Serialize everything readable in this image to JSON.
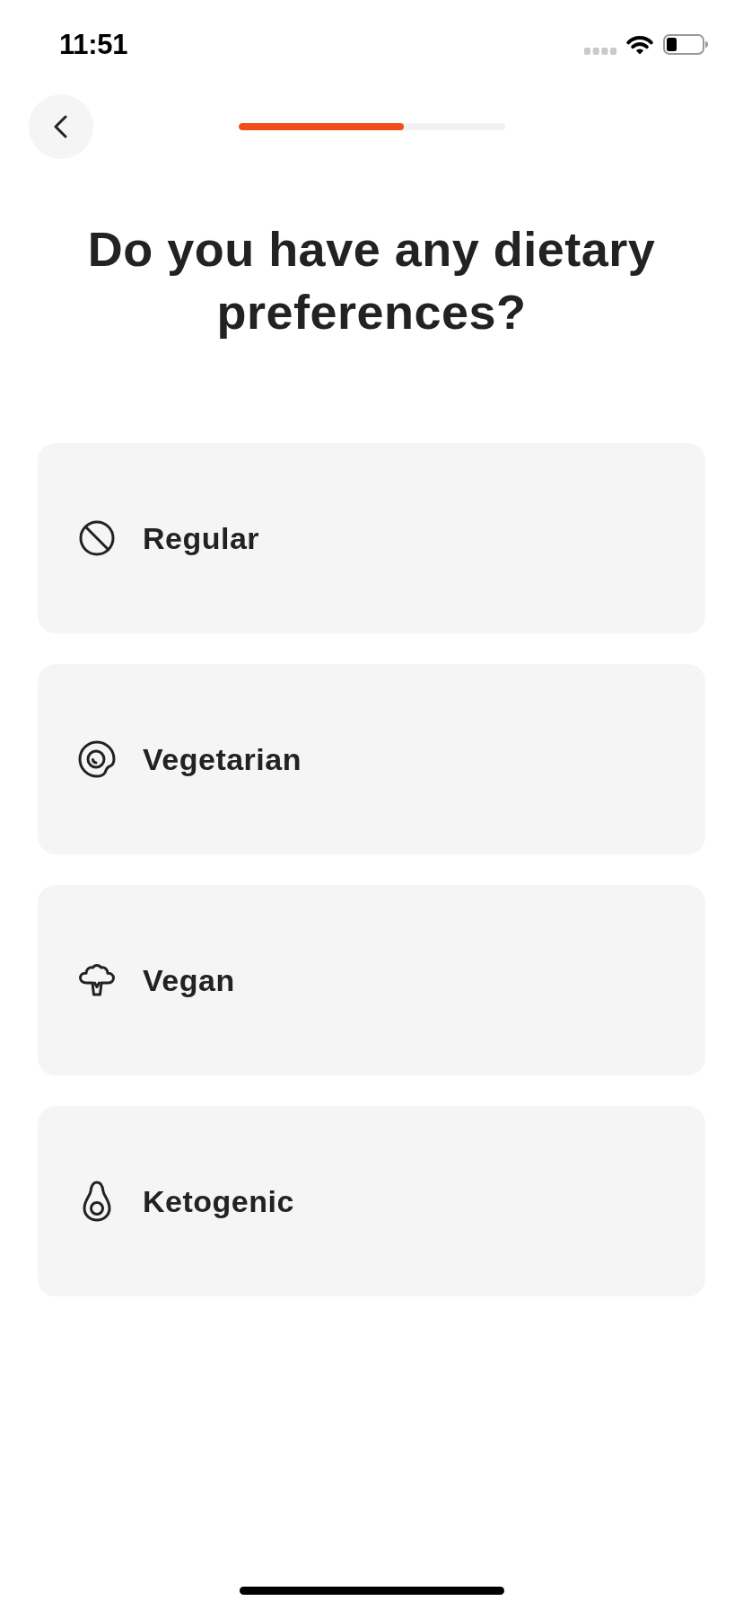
{
  "status_bar": {
    "time": "11:51"
  },
  "header": {
    "progress": {
      "level": 0.62
    }
  },
  "title": "Do you have any dietary preferences?",
  "options": [
    {
      "label": "Regular",
      "selected": false
    },
    {
      "label": "Vegetarian",
      "selected": false
    },
    {
      "label": "Vegan",
      "selected": false
    },
    {
      "label": "Ketogenic",
      "selected": false
    }
  ]
}
